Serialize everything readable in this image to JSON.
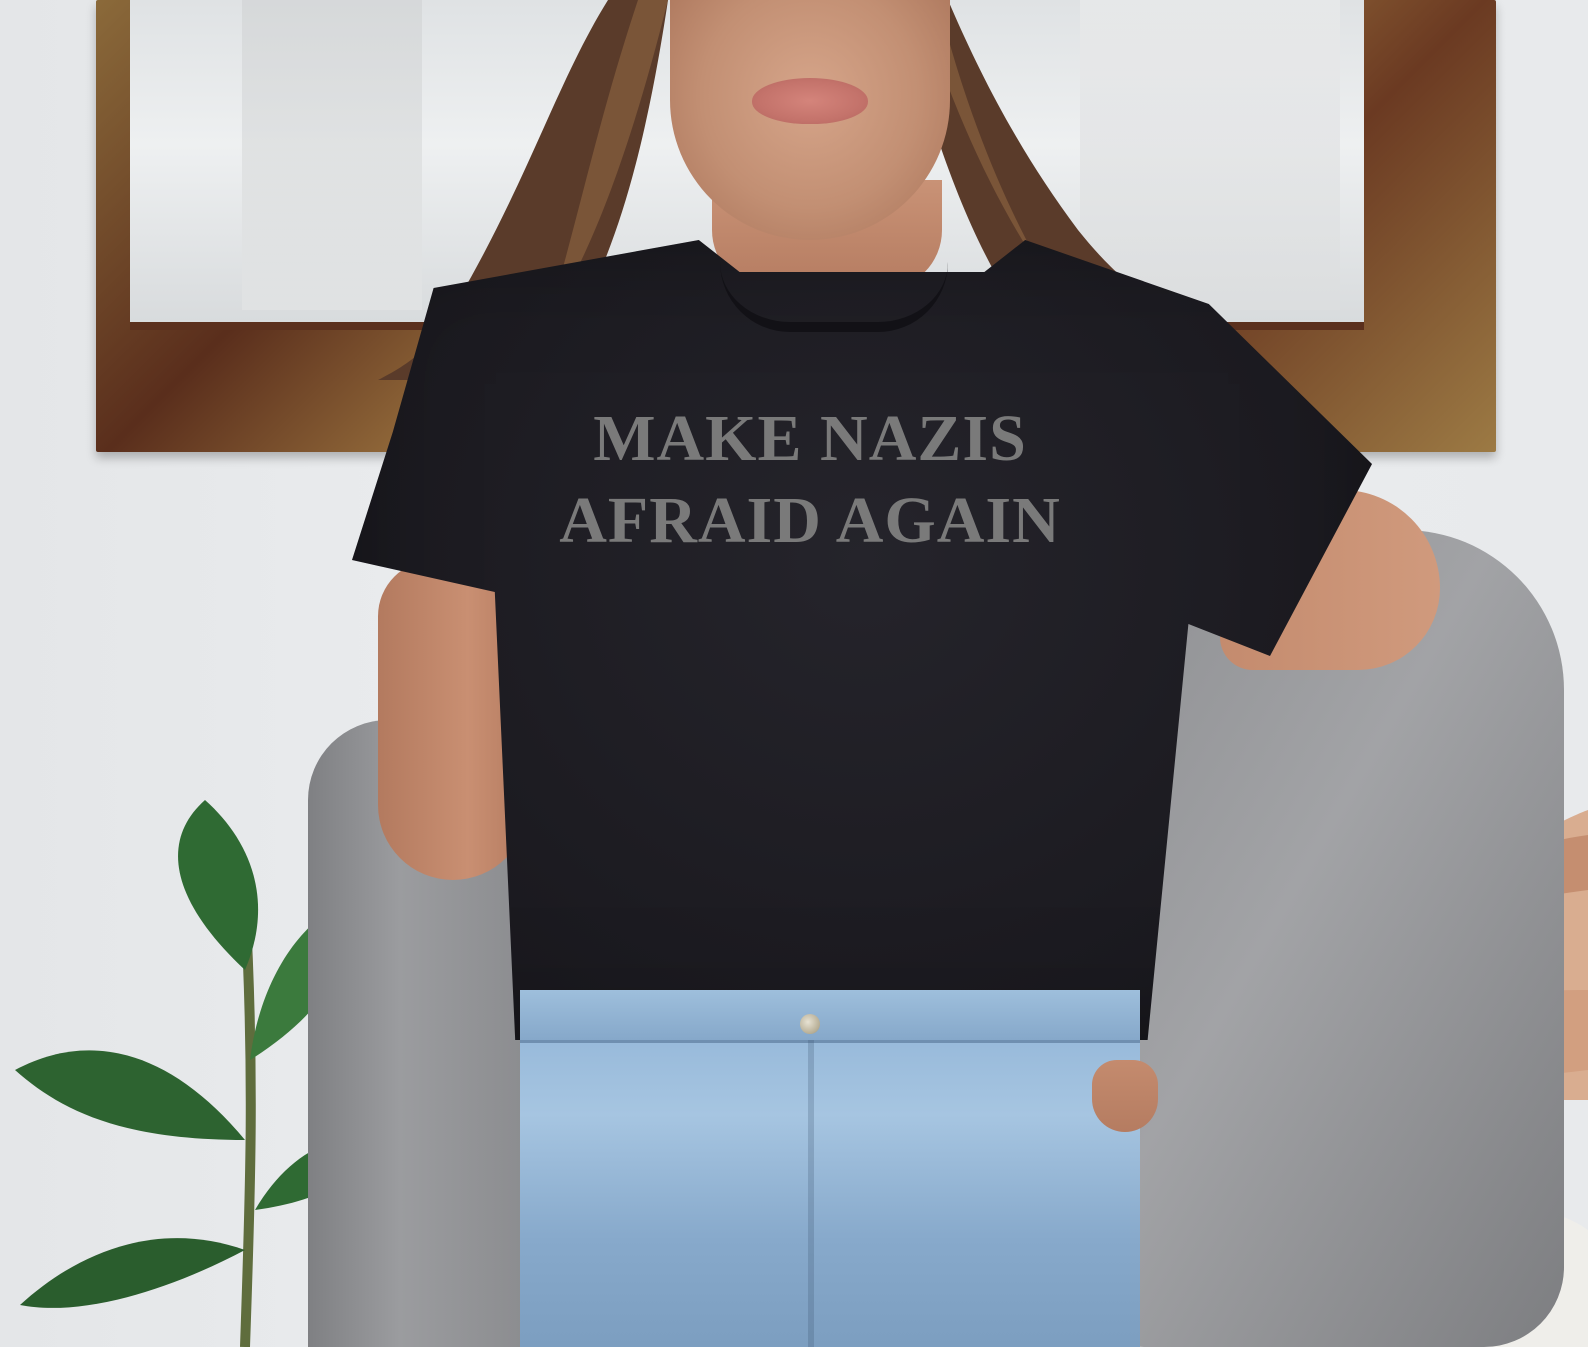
{
  "shirt_print": {
    "line1": "MAKE NAZIS",
    "line2": "AFRAID AGAIN"
  },
  "colors": {
    "background": "#e9eaec",
    "shirt": "#1f1e24",
    "print": "#7a7a7a",
    "cardigan": "#8f9093",
    "jeans": "#9dbcd9"
  }
}
